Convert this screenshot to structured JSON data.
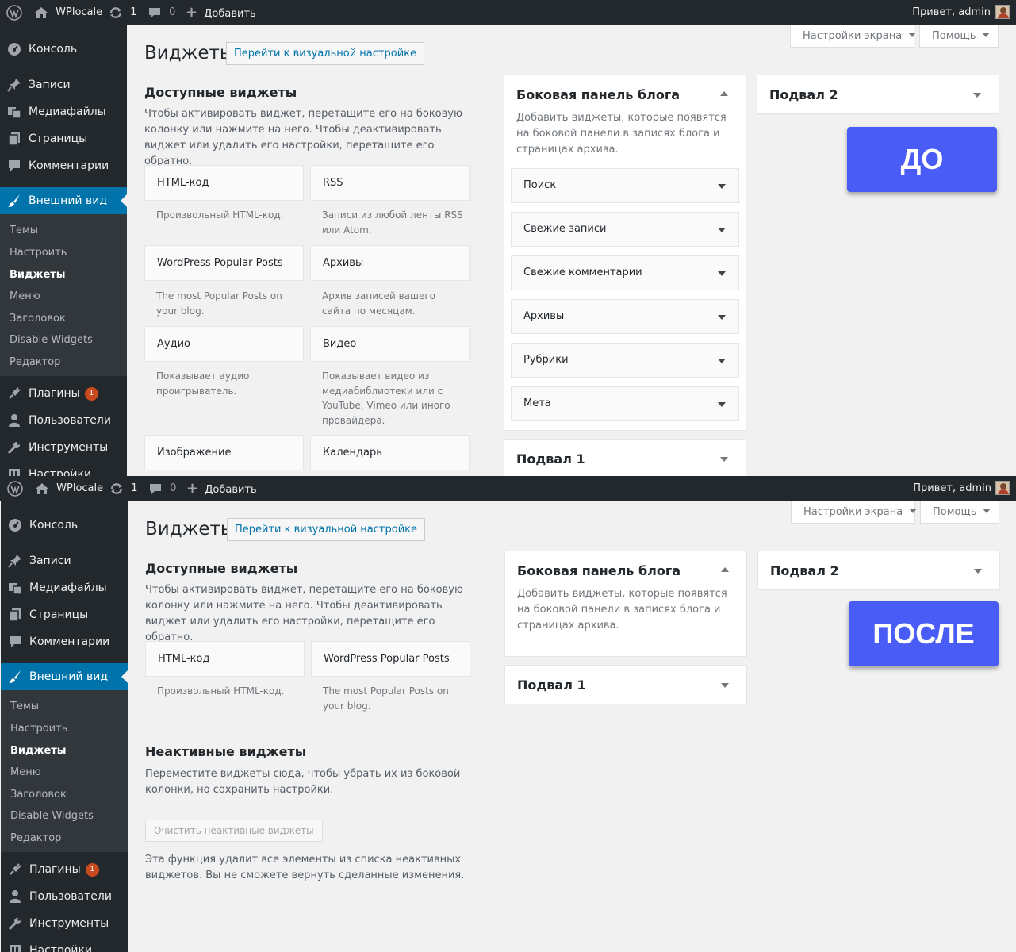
{
  "admin_bar": {
    "site_name": "WPlocale",
    "updates_count": "1",
    "comments_count": "0",
    "add_new_label": "Добавить",
    "greeting": "Привет, admin"
  },
  "sidebar": {
    "console": "Консоль",
    "posts": "Записи",
    "media": "Медиафайлы",
    "pages": "Страницы",
    "comments": "Комментарии",
    "appearance": "Внешний вид",
    "submenu": [
      "Темы",
      "Настроить",
      "Виджеты",
      "Меню",
      "Заголовок",
      "Disable Widgets",
      "Редактор"
    ],
    "plugins": "Плагины",
    "plugins_badge": "1",
    "users": "Пользователи",
    "tools": "Инструменты",
    "settings": "Настройки"
  },
  "screen_options_label": "Настройки экрана",
  "help_label": "Помощь",
  "page_title": "Виджеты",
  "customize_button": "Перейти к визуальной настройке",
  "available_widgets": {
    "heading": "Доступные виджеты",
    "description": "Чтобы активировать виджет, перетащите его на боковую колонку или нажмите на него. Чтобы деактивировать виджет или удалить его настройки, перетащите его обратно."
  },
  "before": {
    "label": "ДО",
    "widgets": [
      {
        "title": "HTML-код",
        "desc": "Произвольный HTML-код."
      },
      {
        "title": "RSS",
        "desc": "Записи из любой ленты RSS или Atom."
      },
      {
        "title": "WordPress Popular Posts",
        "desc": "The most Popular Posts on your blog."
      },
      {
        "title": "Архивы",
        "desc": "Архив записей вашего сайта по месяцам."
      },
      {
        "title": "Аудио",
        "desc": "Показывает аудио проигрыватель."
      },
      {
        "title": "Видео",
        "desc": "Показывает видео из медиабиблиотеки или с YouTube, Vimeo или иного провайдера."
      },
      {
        "title": "Изображение",
        "desc": ""
      },
      {
        "title": "Календарь",
        "desc": ""
      }
    ],
    "sidebar_widgets": [
      "Поиск",
      "Свежие записи",
      "Свежие комментарии",
      "Архивы",
      "Рубрики",
      "Мета"
    ]
  },
  "after": {
    "label": "ПОСЛЕ",
    "widgets": [
      {
        "title": "HTML-код",
        "desc": "Произвольный HTML-код."
      },
      {
        "title": "WordPress Popular Posts",
        "desc": "The most Popular Posts on your blog."
      }
    ],
    "inactive": {
      "heading": "Неактивные виджеты",
      "description": "Переместите виджеты сюда, чтобы убрать их из боковой колонки, но сохранить настройки.",
      "clear_button": "Очистить неактивные виджеты",
      "note": "Эта функция удалит все элементы из списка неактивных виджетов. Вы не сможете вернуть сделанные изменения."
    }
  },
  "blog_sidebar": {
    "title": "Боковая панель блога",
    "description": "Добавить виджеты, которые появятся на боковой панели в записях блога и страницах архива."
  },
  "footer1_title": "Подвал 1",
  "footer2_title": "Подвал 2",
  "colors": {
    "accent": "#0073aa",
    "adminbar": "#23282d",
    "tag": "#4a5cf6"
  }
}
